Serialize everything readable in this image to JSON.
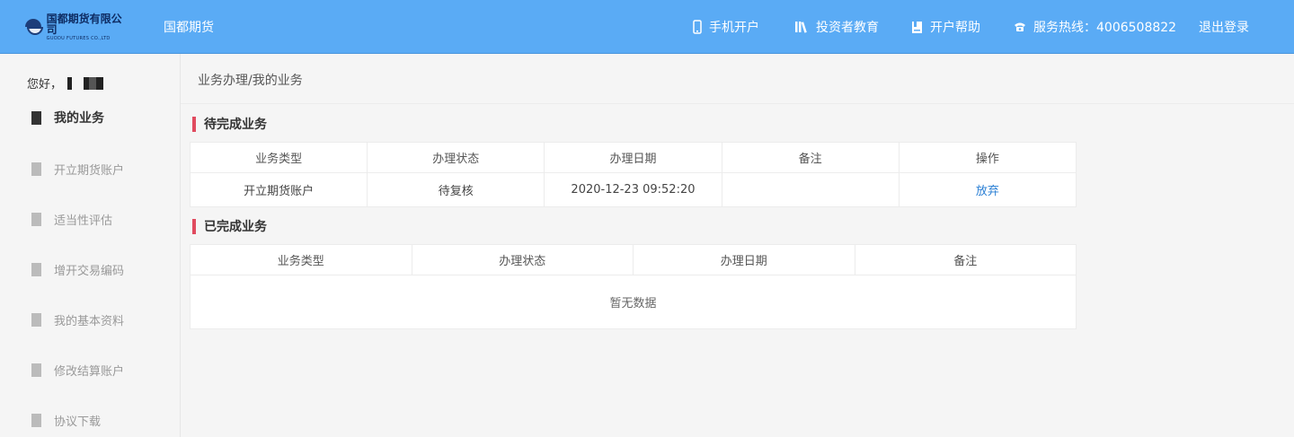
{
  "header": {
    "logo_cn": "国都期货有限公司",
    "logo_en": "GUODU FUTURES CO.,LTD",
    "brand": "国都期货",
    "nav": {
      "mobile_open": "手机开户",
      "investor_edu": "投资者教育",
      "open_help": "开户帮助",
      "hotline": "服务热线：4006508822",
      "logout": "退出登录"
    },
    "icons": {
      "mobile": "mobile-phone-icon",
      "edu": "books-icon",
      "help": "bookmark-icon",
      "hotline": "telephone-icon"
    }
  },
  "sidebar": {
    "greeting": "您好，",
    "items": [
      {
        "label": "我的业务",
        "active": true
      },
      {
        "label": "开立期货账户",
        "active": false
      },
      {
        "label": "适当性评估",
        "active": false
      },
      {
        "label": "增开交易编码",
        "active": false
      },
      {
        "label": "我的基本资料",
        "active": false
      },
      {
        "label": "修改结算账户",
        "active": false
      },
      {
        "label": "协议下载",
        "active": false
      }
    ]
  },
  "main": {
    "breadcrumb": "业务办理/我的业务",
    "pending": {
      "title": "待完成业务",
      "columns": [
        "业务类型",
        "办理状态",
        "办理日期",
        "备注",
        "操作"
      ],
      "rows": [
        {
          "type": "开立期货账户",
          "status": "待复核",
          "date": "2020-12-23 09:52:20",
          "note": "",
          "action": "放弃"
        }
      ]
    },
    "completed": {
      "title": "已完成业务",
      "columns": [
        "业务类型",
        "办理状态",
        "办理日期",
        "备注"
      ],
      "empty_text": "暂无数据"
    }
  },
  "colors": {
    "header_bg": "#5aabf5",
    "accent_mark": "#e04b5f",
    "link": "#2a7fd4"
  }
}
